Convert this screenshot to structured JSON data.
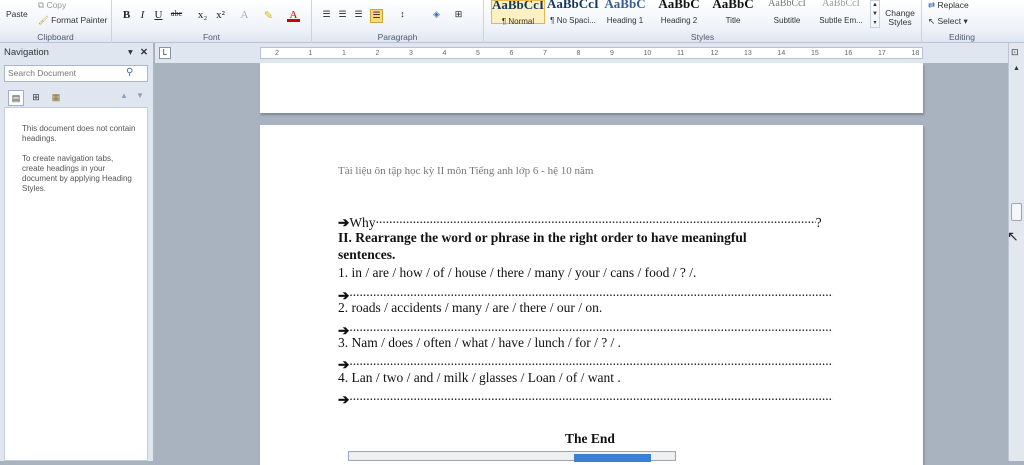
{
  "ribbon": {
    "clipboard": {
      "paste": "Paste",
      "copy": "Copy",
      "format_painter": "Format Painter",
      "label": "Clipboard"
    },
    "font": {
      "label": "Font",
      "bold": "B",
      "italic": "I",
      "underline": "U",
      "strike": "abc",
      "subscript": "x₂",
      "superscript": "x²"
    },
    "paragraph": {
      "label": "Paragraph"
    },
    "styles": {
      "label": "Styles",
      "items": [
        {
          "preview": "AaBbCcI",
          "name": "¶ Normal"
        },
        {
          "preview": "AaBbCcI",
          "name": "¶ No Spaci..."
        },
        {
          "preview": "AaBbC",
          "name": "Heading 1"
        },
        {
          "preview": "AaBbC",
          "name": "Heading 2"
        },
        {
          "preview": "AaBbC",
          "name": "Title"
        },
        {
          "preview": "AaBbCcI",
          "name": "Subtitle"
        },
        {
          "preview": "AaBbCcI",
          "name": "Subtle Em..."
        }
      ],
      "change_styles": "Change Styles"
    },
    "editing": {
      "label": "Editing",
      "replace": "Replace",
      "select": "Select"
    }
  },
  "navigation": {
    "title": "Navigation",
    "search_placeholder": "Search Document",
    "message1": "This document does not contain headings.",
    "message2": "To create navigation tabs, create headings in your document by applying Heading Styles."
  },
  "ruler": {
    "numbers": [
      "2",
      "1",
      "1",
      "2",
      "3",
      "4",
      "5",
      "6",
      "7",
      "8",
      "9",
      "10",
      "11",
      "12",
      "13",
      "14",
      "15",
      "16",
      "17",
      "18"
    ]
  },
  "document": {
    "header": "Tài liệu ôn tập học kỳ II môn Tiếng anh lớp 6 - hệ 10 năm",
    "lines": [
      {
        "text": "Why",
        "dots": true,
        "end": "?"
      },
      {
        "text": "II. Rearrange the word or phrase in the right order to have meaningful",
        "bold": true
      },
      {
        "text": "sentences.",
        "bold": true
      },
      {
        "text": "1. in / are / how / of / house / there / many /  your / cans / food / ? /."
      },
      {
        "text": "",
        "dots": true
      },
      {
        "text": "2. roads / accidents / many / are / there / our / on."
      },
      {
        "text": "",
        "dots": true
      },
      {
        "text": "3. Nam / does / often / what / have / lunch / for / ? / ."
      },
      {
        "text": "",
        "dots": true
      },
      {
        "text": "4. Lan / two / and / milk / glasses / Loan / of / want ."
      },
      {
        "text": "",
        "dots": true
      }
    ],
    "the_end": "The End"
  },
  "colors": {
    "accent": "#17365d",
    "app_bg": "#a9b3bf",
    "nav_bg": "#dfe6ef"
  }
}
